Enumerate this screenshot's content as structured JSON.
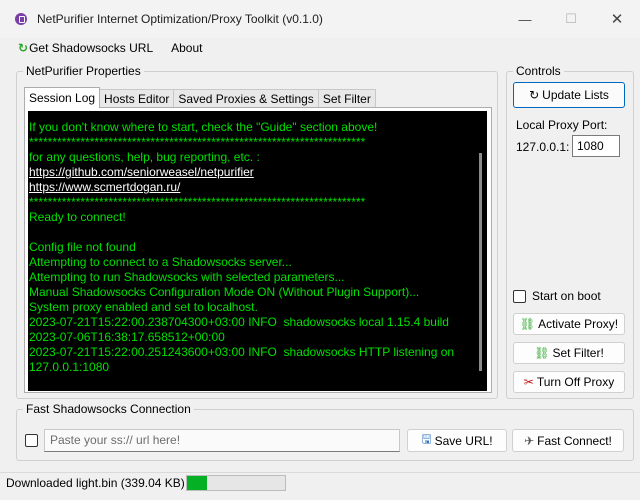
{
  "window": {
    "title": "NetPurifier Internet Optimization/Proxy Toolkit (v0.1.0)"
  },
  "menu": {
    "items": [
      "Get Shadowsocks URL",
      "About"
    ]
  },
  "properties": {
    "title": "NetPurifier Properties",
    "tabs": [
      "Session Log",
      "Hosts Editor",
      "Saved Proxies & Settings",
      "Set Filter"
    ],
    "active_tab": "Session Log",
    "log_lines": [
      {
        "text": "If you don't know where to start, check the \"Guide\" section above!",
        "link": false
      },
      {
        "text": "************************************************************************",
        "link": false
      },
      {
        "text": "for any questions, help, bug reporting, etc. :",
        "link": false
      },
      {
        "text": "https://github.com/seniorweasel/netpurifier",
        "link": true
      },
      {
        "text": "https://www.scmertdogan.ru/",
        "link": true
      },
      {
        "text": "************************************************************************",
        "link": false
      },
      {
        "text": "Ready to connect!",
        "link": false
      },
      {
        "text": "",
        "link": false
      },
      {
        "text": "Config file not found",
        "link": false
      },
      {
        "text": "Attempting to connect to a Shadowsocks server...",
        "link": false
      },
      {
        "text": "Attempting to run Shadowsocks with selected parameters...",
        "link": false
      },
      {
        "text": "Manual Shadowsocks Configuration Mode ON (Without Plugin Support)...",
        "link": false
      },
      {
        "text": "System proxy enabled and set to localhost.",
        "link": false
      },
      {
        "text": "2023-07-21T15:22:00.238704300+03:00 INFO  shadowsocks local 1.15.4 build",
        "link": false
      },
      {
        "text": "2023-07-06T16:38:17.658512+00:00",
        "link": false
      },
      {
        "text": "2023-07-21T15:22:00.251243600+03:00 INFO  shadowsocks HTTP listening on",
        "link": false
      },
      {
        "text": "127.0.0.1:1080",
        "link": false
      }
    ]
  },
  "controls": {
    "title": "Controls",
    "update_lists": "Update Lists",
    "local_proxy_port_label": "Local Proxy Port:",
    "host": "127.0.0.1:",
    "port": "1080",
    "start_on_boot": "Start on boot",
    "start_on_boot_checked": false,
    "activate_proxy": "Activate Proxy!",
    "set_filter": "Set Filter!",
    "turn_off_proxy": "Turn Off Proxy"
  },
  "fast_connection": {
    "title": "Fast Shadowsocks Connection",
    "url_placeholder": "Paste your ss:// url here!",
    "url_value": "",
    "checked": false,
    "save_url": "Save URL!",
    "fast_connect": "Fast Connect!"
  },
  "status": {
    "text": "Downloaded light.bin (339.04 KB)",
    "progress": 0.2
  },
  "colors": {
    "console_bg": "#000000",
    "console_text": "#00e000",
    "accent": "#0067c0",
    "progress": "#06b025"
  },
  "icons": {
    "app": "netpurifier-app-icon",
    "menu": "shadowsocks-icon",
    "update": "refresh-icon",
    "activate": "link-icon",
    "filter": "link-icon",
    "turn_off": "unlink-icon",
    "save": "save-icon",
    "connect": "plane-icon"
  }
}
